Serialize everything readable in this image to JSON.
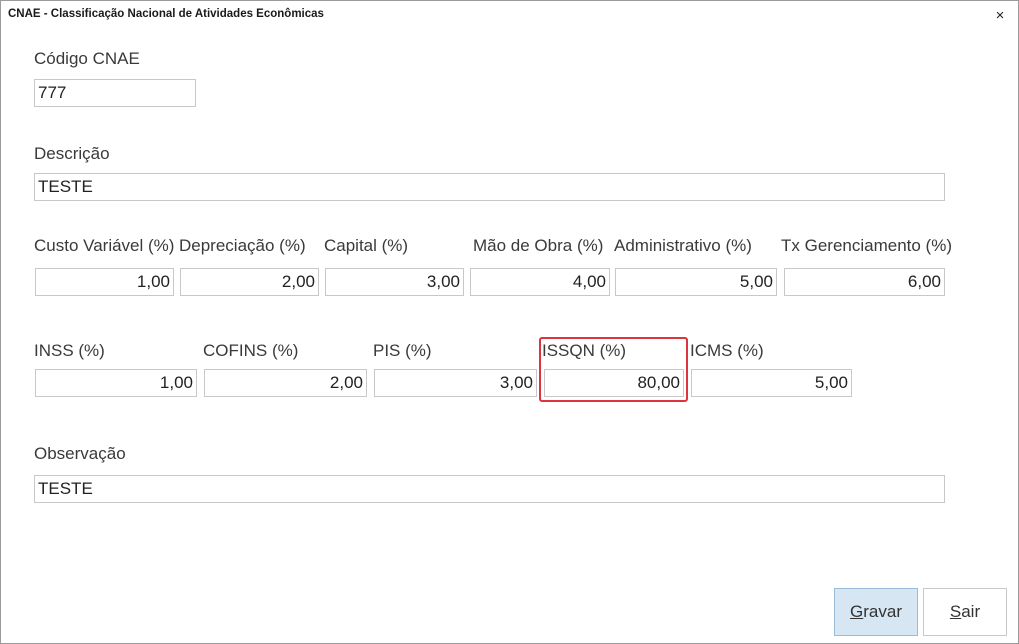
{
  "window": {
    "title": "CNAE - Classificação Nacional de Atividades Econômicas",
    "close_glyph": "×"
  },
  "codigo": {
    "label": "Código CNAE",
    "value": "777"
  },
  "descricao": {
    "label": "Descrição",
    "value": "TESTE"
  },
  "custos": [
    {
      "label": "Custo Variável (%)",
      "value": "1,00"
    },
    {
      "label": "Depreciação (%)",
      "value": "2,00"
    },
    {
      "label": "Capital (%)",
      "value": "3,00"
    },
    {
      "label": "Mão de Obra (%)",
      "value": "4,00"
    },
    {
      "label": "Administrativo (%)",
      "value": "5,00"
    },
    {
      "label": "Tx Gerenciamento (%)",
      "value": "6,00"
    }
  ],
  "impostos": [
    {
      "label": "INSS (%)",
      "value": "1,00"
    },
    {
      "label": "COFINS (%)",
      "value": "2,00"
    },
    {
      "label": "PIS (%)",
      "value": "3,00"
    },
    {
      "label": "ISSQN (%)",
      "value": "80,00"
    },
    {
      "label": "ICMS (%)",
      "value": "5,00"
    }
  ],
  "observacao": {
    "label": "Observação",
    "value": "TESTE"
  },
  "buttons": {
    "gravar_first": "G",
    "gravar_rest": "ravar",
    "sair_first": "S",
    "sair_rest": "air"
  },
  "colors": {
    "highlight_border": "#d9363e",
    "primary_button_bg": "#d6e6f3"
  }
}
